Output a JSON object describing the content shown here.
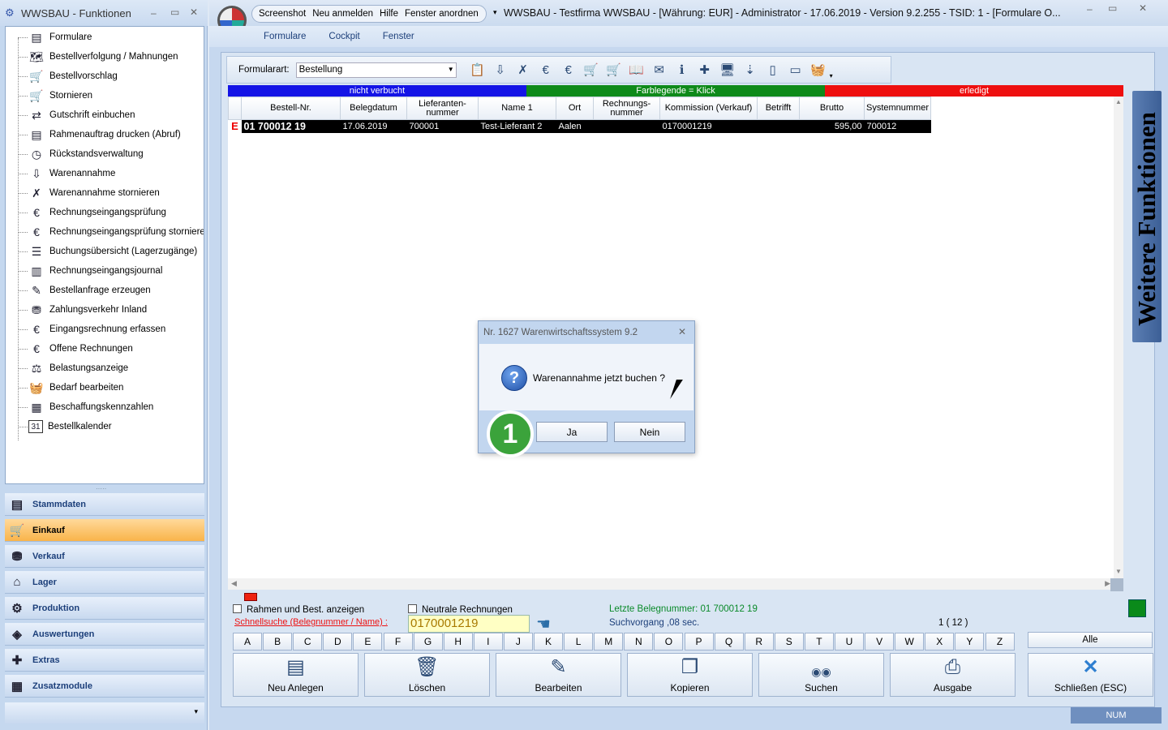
{
  "left_panel": {
    "title": "WWSBAU - Funktionen",
    "window_buttons": [
      "–",
      "▭",
      "✕"
    ],
    "tree": [
      {
        "label": "Formulare",
        "icon": "document-icon"
      },
      {
        "label": "Bestellverfolgung / Mahnungen",
        "icon": "map-icon"
      },
      {
        "label": "Bestellvorschlag",
        "icon": "cart-icon"
      },
      {
        "label": "Stornieren",
        "icon": "cart-cancel-icon"
      },
      {
        "label": "Gutschrift einbuchen",
        "icon": "credit-icon"
      },
      {
        "label": "Rahmenauftrag drucken (Abruf)",
        "icon": "print-document-icon"
      },
      {
        "label": "Rückstandsverwaltung",
        "icon": "clock-icon"
      },
      {
        "label": "Warenannahme",
        "icon": "goods-receipt-icon"
      },
      {
        "label": "Warenannahme stornieren",
        "icon": "goods-receipt-cancel-icon"
      },
      {
        "label": "Rechnungseingangsprüfung",
        "icon": "euro-document-icon"
      },
      {
        "label": "Rechnungseingangsprüfung stornieren",
        "icon": "euro-cancel-icon"
      },
      {
        "label": "Buchungsübersicht (Lagerzugänge)",
        "icon": "list-icon"
      },
      {
        "label": "Rechnungseingangsjournal",
        "icon": "journal-icon"
      },
      {
        "label": "Bestellanfrage erzeugen",
        "icon": "request-icon"
      },
      {
        "label": "Zahlungsverkehr Inland",
        "icon": "payment-icon"
      },
      {
        "label": "Eingangsrechnung erfassen",
        "icon": "euro-document-icon"
      },
      {
        "label": "Offene Rechnungen",
        "icon": "euro-document-icon"
      },
      {
        "label": "Belastungsanzeige",
        "icon": "weight-icon"
      },
      {
        "label": "Bedarf bearbeiten",
        "icon": "basket-icon"
      },
      {
        "label": "Beschaffungskennzahlen",
        "icon": "table-icon"
      },
      {
        "label": "Bestellkalender",
        "icon": "calendar-icon"
      }
    ],
    "nav": [
      {
        "label": "Stammdaten",
        "icon": "stammdaten-icon",
        "active": false
      },
      {
        "label": "Einkauf",
        "icon": "cart-icon",
        "active": true
      },
      {
        "label": "Verkauf",
        "icon": "cash-register-icon",
        "active": false
      },
      {
        "label": "Lager",
        "icon": "warehouse-icon",
        "active": false
      },
      {
        "label": "Produktion",
        "icon": "production-icon",
        "active": false
      },
      {
        "label": "Auswertungen",
        "icon": "analytics-icon",
        "active": false
      },
      {
        "label": "Extras",
        "icon": "extras-icon",
        "active": false
      },
      {
        "label": "Zusatzmodule",
        "icon": "modules-icon",
        "active": false
      }
    ]
  },
  "main": {
    "menu_pill": [
      "Screenshot",
      "Neu anmelden",
      "Hilfe",
      "Fenster anordnen"
    ],
    "title": "WWSBAU - Testfirma WWSBAU - [Währung: EUR] - Administrator - 17.06.2019 - Version 9.2.255 - TSID: 1  - [Formulare O...",
    "menubar": [
      "Formulare",
      "Cockpit",
      "Fenster"
    ],
    "form_label": "Formularart:",
    "form_value": "Bestellung",
    "legend": [
      {
        "label": "nicht verbucht",
        "color": "#1414e6"
      },
      {
        "label": "Farblegende = Klick",
        "color": "#0e8a1a"
      },
      {
        "label": "erledigt",
        "color": "#ee0f0f"
      }
    ],
    "columns": [
      "Bestell-Nr.",
      "Belegdatum",
      "Lieferanten-nummer",
      "Name 1",
      "Ort",
      "Rechnungs-nummer",
      "Kommission (Verkauf)",
      "Betrifft",
      "Brutto",
      "Systemnummer"
    ],
    "row": {
      "flag": "E",
      "bestell_nr": "01 700012 19",
      "belegdatum": "17.06.2019",
      "lieferant": "700001",
      "name": "Test-Lieferant 2",
      "ort": "Aalen",
      "rechnung": "",
      "kommission": "0170001219",
      "betrifft": "",
      "brutto": "595,00",
      "system": "700012"
    },
    "check_rahmen": "Rahmen und Best. anzeigen",
    "check_neutral": "Neutrale Rechnungen",
    "quick_label": "Schnellsuche (Belegnummer / Name) :",
    "quick_value": "0170001219",
    "last_number": "Letzte Belegnummer: 01 700012 19",
    "search_time": "Suchvorgang ,08 sec.",
    "counter": "1  ( 12 )",
    "letters": [
      "A",
      "B",
      "C",
      "D",
      "E",
      "F",
      "G",
      "H",
      "I",
      "J",
      "K",
      "L",
      "M",
      "N",
      "O",
      "P",
      "Q",
      "R",
      "S",
      "T",
      "U",
      "V",
      "W",
      "X",
      "Y",
      "Z"
    ],
    "all_label": "Alle",
    "buttons": [
      {
        "label": "Neu Anlegen",
        "icon": "new-document-icon"
      },
      {
        "label": "Löschen",
        "icon": "trash-icon"
      },
      {
        "label": "Bearbeiten",
        "icon": "edit-icon"
      },
      {
        "label": "Kopieren",
        "icon": "copy-icon"
      },
      {
        "label": "Suchen",
        "icon": "binoculars-icon"
      },
      {
        "label": "Ausgabe",
        "icon": "printer-icon"
      },
      {
        "label": "Schließen (ESC)",
        "icon": "close-x-icon"
      }
    ],
    "side_tab": "Weitere Funktionen",
    "status": "NUM"
  },
  "dialog": {
    "title": "Nr. 1627 Warenwirtschaftssystem 9.2",
    "message": "Warenannahme jetzt buchen ?",
    "yes": "Ja",
    "no": "Nein"
  },
  "step_badge": "1"
}
